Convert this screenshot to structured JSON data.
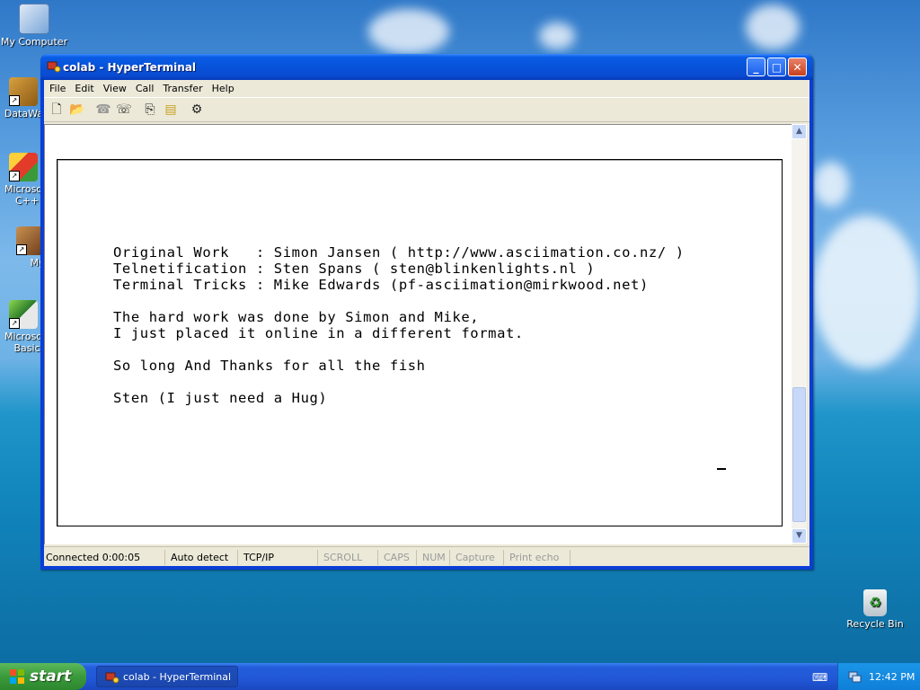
{
  "desktop": {
    "icons": [
      {
        "label": "My Computer",
        "icon": "my-computer-icon"
      },
      {
        "label": "DataWa",
        "icon": "shortcut-icon"
      },
      {
        "label": "Microsoft C++",
        "icon": "visual-cpp-icon"
      },
      {
        "label": "Myp",
        "icon": "shortcut-icon"
      },
      {
        "label": "Microsoft Basic",
        "icon": "visual-basic-icon"
      },
      {
        "label": "Recycle Bin",
        "icon": "recycle-bin-icon"
      }
    ]
  },
  "window": {
    "title": "colab - HyperTerminal",
    "controls": {
      "minimize": "_",
      "maximize": "□",
      "close": "✕"
    },
    "menu": [
      "File",
      "Edit",
      "View",
      "Call",
      "Transfer",
      "Help"
    ],
    "toolbar": [
      "new-icon",
      "open-icon",
      "dial-icon",
      "disconnect-icon",
      "send-icon",
      "receive-icon",
      "properties-icon"
    ],
    "terminal_lines": [
      "Original Work   : Simon Jansen ( http://www.asciimation.co.nz/ )",
      "Telnetification : Sten Spans ( sten@blinkenlights.nl )",
      "Terminal Tricks : Mike Edwards (pf-asciimation@mirkwood.net)",
      "The hard work was done by Simon and Mike,",
      "I just placed it online in a different format.",
      "So long And Thanks for all the fish",
      "Sten (I just need a Hug)"
    ],
    "status": [
      {
        "text": "Connected 0:00:05",
        "active": true
      },
      {
        "text": "Auto detect",
        "active": true
      },
      {
        "text": "TCP/IP",
        "active": true
      },
      {
        "text": "SCROLL",
        "active": false
      },
      {
        "text": "CAPS",
        "active": false
      },
      {
        "text": "NUM",
        "active": false
      },
      {
        "text": "Capture",
        "active": false
      },
      {
        "text": "Print echo",
        "active": false
      }
    ]
  },
  "taskbar": {
    "start_label": "start",
    "task_label": "colab - HyperTerminal",
    "clock": "12:42 PM"
  }
}
